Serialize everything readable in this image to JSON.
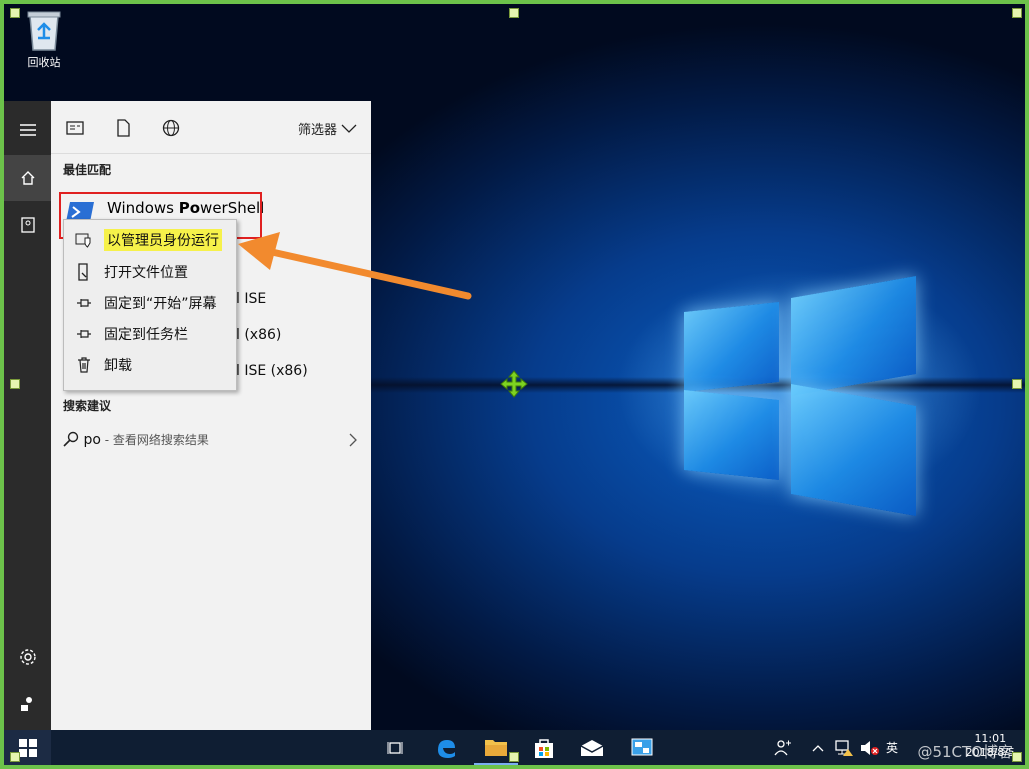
{
  "desktop": {
    "recycle_bin_label": "回收站"
  },
  "start_menu": {
    "filter_label": "筛选器",
    "best_match_heading": "最佳匹配",
    "best_match": {
      "title_prefix": "Windows ",
      "title_bold": "Po",
      "title_suffix": "werShell"
    },
    "partial_results": [
      "l ISE",
      "l (x86)",
      "l ISE (x86)"
    ],
    "search_suggestions_heading": "搜索建议",
    "suggestion": {
      "query": "po",
      "description": " - 查看网络搜索结果"
    },
    "search_value": "po"
  },
  "context_menu": {
    "items": [
      {
        "label": "以管理员身份运行",
        "icon": "shield-window-icon",
        "highlighted": true
      },
      {
        "label": "打开文件位置",
        "icon": "folder-location-icon"
      },
      {
        "label": "固定到“开始”屏幕",
        "icon": "pin-icon"
      },
      {
        "label": "固定到任务栏",
        "icon": "pin-icon"
      },
      {
        "label": "卸载",
        "icon": "trash-icon"
      }
    ]
  },
  "taskbar": {
    "ime_label": "英",
    "time": "11:01",
    "date": "2018/8/5",
    "watermark": "@51CTO博客"
  },
  "colors": {
    "accent_arrow": "#f28a2e",
    "highlight_box": "#e02020",
    "highlight_fill": "#f6f14a"
  }
}
